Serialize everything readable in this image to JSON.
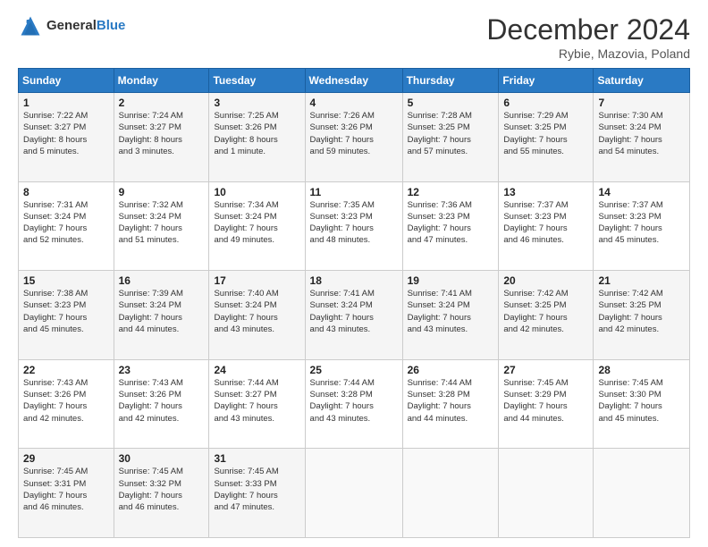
{
  "header": {
    "logo_line1": "General",
    "logo_line2": "Blue",
    "month_title": "December 2024",
    "subtitle": "Rybie, Mazovia, Poland"
  },
  "weekdays": [
    "Sunday",
    "Monday",
    "Tuesday",
    "Wednesday",
    "Thursday",
    "Friday",
    "Saturday"
  ],
  "weeks": [
    [
      {
        "day": "1",
        "info": "Sunrise: 7:22 AM\nSunset: 3:27 PM\nDaylight: 8 hours\nand 5 minutes."
      },
      {
        "day": "2",
        "info": "Sunrise: 7:24 AM\nSunset: 3:27 PM\nDaylight: 8 hours\nand 3 minutes."
      },
      {
        "day": "3",
        "info": "Sunrise: 7:25 AM\nSunset: 3:26 PM\nDaylight: 8 hours\nand 1 minute."
      },
      {
        "day": "4",
        "info": "Sunrise: 7:26 AM\nSunset: 3:26 PM\nDaylight: 7 hours\nand 59 minutes."
      },
      {
        "day": "5",
        "info": "Sunrise: 7:28 AM\nSunset: 3:25 PM\nDaylight: 7 hours\nand 57 minutes."
      },
      {
        "day": "6",
        "info": "Sunrise: 7:29 AM\nSunset: 3:25 PM\nDaylight: 7 hours\nand 55 minutes."
      },
      {
        "day": "7",
        "info": "Sunrise: 7:30 AM\nSunset: 3:24 PM\nDaylight: 7 hours\nand 54 minutes."
      }
    ],
    [
      {
        "day": "8",
        "info": "Sunrise: 7:31 AM\nSunset: 3:24 PM\nDaylight: 7 hours\nand 52 minutes."
      },
      {
        "day": "9",
        "info": "Sunrise: 7:32 AM\nSunset: 3:24 PM\nDaylight: 7 hours\nand 51 minutes."
      },
      {
        "day": "10",
        "info": "Sunrise: 7:34 AM\nSunset: 3:24 PM\nDaylight: 7 hours\nand 49 minutes."
      },
      {
        "day": "11",
        "info": "Sunrise: 7:35 AM\nSunset: 3:23 PM\nDaylight: 7 hours\nand 48 minutes."
      },
      {
        "day": "12",
        "info": "Sunrise: 7:36 AM\nSunset: 3:23 PM\nDaylight: 7 hours\nand 47 minutes."
      },
      {
        "day": "13",
        "info": "Sunrise: 7:37 AM\nSunset: 3:23 PM\nDaylight: 7 hours\nand 46 minutes."
      },
      {
        "day": "14",
        "info": "Sunrise: 7:37 AM\nSunset: 3:23 PM\nDaylight: 7 hours\nand 45 minutes."
      }
    ],
    [
      {
        "day": "15",
        "info": "Sunrise: 7:38 AM\nSunset: 3:23 PM\nDaylight: 7 hours\nand 45 minutes."
      },
      {
        "day": "16",
        "info": "Sunrise: 7:39 AM\nSunset: 3:24 PM\nDaylight: 7 hours\nand 44 minutes."
      },
      {
        "day": "17",
        "info": "Sunrise: 7:40 AM\nSunset: 3:24 PM\nDaylight: 7 hours\nand 43 minutes."
      },
      {
        "day": "18",
        "info": "Sunrise: 7:41 AM\nSunset: 3:24 PM\nDaylight: 7 hours\nand 43 minutes."
      },
      {
        "day": "19",
        "info": "Sunrise: 7:41 AM\nSunset: 3:24 PM\nDaylight: 7 hours\nand 43 minutes."
      },
      {
        "day": "20",
        "info": "Sunrise: 7:42 AM\nSunset: 3:25 PM\nDaylight: 7 hours\nand 42 minutes."
      },
      {
        "day": "21",
        "info": "Sunrise: 7:42 AM\nSunset: 3:25 PM\nDaylight: 7 hours\nand 42 minutes."
      }
    ],
    [
      {
        "day": "22",
        "info": "Sunrise: 7:43 AM\nSunset: 3:26 PM\nDaylight: 7 hours\nand 42 minutes."
      },
      {
        "day": "23",
        "info": "Sunrise: 7:43 AM\nSunset: 3:26 PM\nDaylight: 7 hours\nand 42 minutes."
      },
      {
        "day": "24",
        "info": "Sunrise: 7:44 AM\nSunset: 3:27 PM\nDaylight: 7 hours\nand 43 minutes."
      },
      {
        "day": "25",
        "info": "Sunrise: 7:44 AM\nSunset: 3:28 PM\nDaylight: 7 hours\nand 43 minutes."
      },
      {
        "day": "26",
        "info": "Sunrise: 7:44 AM\nSunset: 3:28 PM\nDaylight: 7 hours\nand 44 minutes."
      },
      {
        "day": "27",
        "info": "Sunrise: 7:45 AM\nSunset: 3:29 PM\nDaylight: 7 hours\nand 44 minutes."
      },
      {
        "day": "28",
        "info": "Sunrise: 7:45 AM\nSunset: 3:30 PM\nDaylight: 7 hours\nand 45 minutes."
      }
    ],
    [
      {
        "day": "29",
        "info": "Sunrise: 7:45 AM\nSunset: 3:31 PM\nDaylight: 7 hours\nand 46 minutes."
      },
      {
        "day": "30",
        "info": "Sunrise: 7:45 AM\nSunset: 3:32 PM\nDaylight: 7 hours\nand 46 minutes."
      },
      {
        "day": "31",
        "info": "Sunrise: 7:45 AM\nSunset: 3:33 PM\nDaylight: 7 hours\nand 47 minutes."
      },
      {
        "day": "",
        "info": ""
      },
      {
        "day": "",
        "info": ""
      },
      {
        "day": "",
        "info": ""
      },
      {
        "day": "",
        "info": ""
      }
    ]
  ]
}
